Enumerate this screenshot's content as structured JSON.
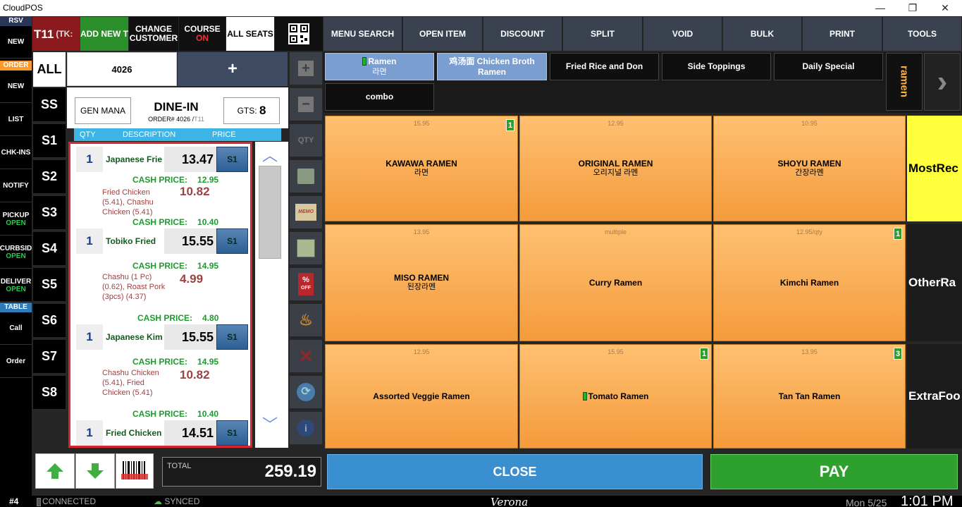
{
  "window": {
    "title": "CloudPOS"
  },
  "leftbar": {
    "rsv_header": "RSV",
    "rsv_new": "NEW",
    "order_header": "ORDER",
    "order_new": "NEW",
    "list": "LIST",
    "chk_ins": "CHK-INS",
    "notify": "NOTIFY",
    "pickup": "PICKUP",
    "pickup_status": "OPEN",
    "curbside": "CURBSID",
    "curbside_status": "OPEN",
    "delivery": "DELIVER",
    "delivery_status": "OPEN",
    "table_header": "TABLE",
    "call": "Call",
    "order": "Order"
  },
  "header": {
    "table_label": "T11",
    "table_suffix": "(TK:",
    "add_new": "ADD NEW T",
    "change_customer": "CHANGE CUSTOMER",
    "course": "COURSE",
    "course_status": "ON",
    "all_seats": "ALL SEATS"
  },
  "toolbar": [
    "MENU SEARCH",
    "OPEN ITEM",
    "DISCOUNT",
    "SPLIT",
    "VOID",
    "BULK",
    "PRINT",
    "TOOLS"
  ],
  "seats": [
    "ALL",
    "SS",
    "S1",
    "S2",
    "S3",
    "S4",
    "S5",
    "S6",
    "S7",
    "S8"
  ],
  "order": {
    "number_field": "4026",
    "add_label": "+",
    "server": "GEN MANA",
    "type": "DINE-IN",
    "order_prefix": "ORDER# 4026 /",
    "order_table": "T11",
    "guests_label": "GTS:",
    "guests": "8"
  },
  "columns": {
    "qty": "QTY",
    "description": "DESCRIPTION",
    "price": "PRICE"
  },
  "items": [
    {
      "qty": "1",
      "desc": "Japanese Frie",
      "price": "13.47",
      "seat": "S1",
      "cash_label": "CASH PRICE:",
      "cash": "12.95",
      "mods": "Fried Chicken (5.41), Chashu Chicken (5.41)",
      "mod_price": "10.82",
      "mod_cash_label": "CASH PRICE:",
      "mod_cash": "10.40"
    },
    {
      "qty": "1",
      "desc": "Tobiko Fried",
      "price": "15.55",
      "seat": "S1",
      "cash_label": "CASH PRICE:",
      "cash": "14.95",
      "mods": "Chashu (1 Pc) (0.62), Roast Pork (3pcs) (4.37)",
      "mod_price": "4.99",
      "mod_cash_label": "CASH PRICE:",
      "mod_cash": "4.80"
    },
    {
      "qty": "1",
      "desc": "Japanese Kim",
      "price": "15.55",
      "seat": "S1",
      "cash_label": "CASH PRICE:",
      "cash": "14.95",
      "mods": "Chashu Chicken (5.41), Fried Chicken (5.41)",
      "mod_price": "10.82",
      "mod_cash_label": "CASH PRICE:",
      "mod_cash": "10.40"
    },
    {
      "qty": "1",
      "desc": "Fried Chicken",
      "price": "14.51",
      "seat": "S1"
    }
  ],
  "tools": {
    "qty": "QTY",
    "memo": "MEMO",
    "off": "OFF"
  },
  "categories": [
    {
      "name": "Ramen",
      "sub": "라면"
    },
    {
      "name": "鸡汤面 Chicken Broth",
      "sub": "Ramen"
    },
    {
      "name": "Fried Rice and Don",
      "sub": ""
    },
    {
      "name": "Side Toppings",
      "sub": ""
    },
    {
      "name": "Daily Special",
      "sub": ""
    },
    {
      "name": "combo",
      "sub": ""
    }
  ],
  "category_group": "ramen",
  "menu": [
    {
      "price": "15.95",
      "name": "KAWAWA RAMEN",
      "kr": "라면",
      "badge": "1"
    },
    {
      "price": "12.95",
      "name": "ORIGINAL RAMEN",
      "kr": "오리지널 라멘",
      "badge": ""
    },
    {
      "price": "10.95",
      "name": "SHOYU RAMEN",
      "kr": "간장라멘",
      "badge": ""
    },
    {
      "price": "13.95",
      "name": "MISO RAMEN",
      "kr": "된장라멘",
      "badge": ""
    },
    {
      "price": "multiple",
      "name": "Curry Ramen",
      "kr": "",
      "badge": ""
    },
    {
      "price": "12.95/qty",
      "name": "Kimchi Ramen",
      "kr": "",
      "badge": "1"
    },
    {
      "price": "12.95",
      "name": "Assorted Veggie Ramen",
      "kr": "",
      "badge": ""
    },
    {
      "price": "15.95",
      "name": "Tomato Ramen",
      "kr": "",
      "badge": "1"
    },
    {
      "price": "13.95",
      "name": "Tan Tan Ramen",
      "kr": "",
      "badge": "3"
    }
  ],
  "side_buttons": [
    "MostRec",
    "OtherRa",
    "ExtraFoo"
  ],
  "footer": {
    "total_label": "TOTAL",
    "total": "259.19",
    "close": "CLOSE",
    "pay": "PAY"
  },
  "statusbar": {
    "station": "#4",
    "connected": "CONNECTED",
    "synced": "SYNCED",
    "brand": "Verona",
    "date": "Mon 5/25",
    "time": "1:01 PM"
  },
  "colors": {
    "accent_blue": "#3cb4e6",
    "pay_green": "#2ea02e",
    "close_blue": "#3a8fd0",
    "tile_orange": "#f7a64c",
    "highlight_yellow": "#ffff3c",
    "selection_red": "#d8262e"
  }
}
